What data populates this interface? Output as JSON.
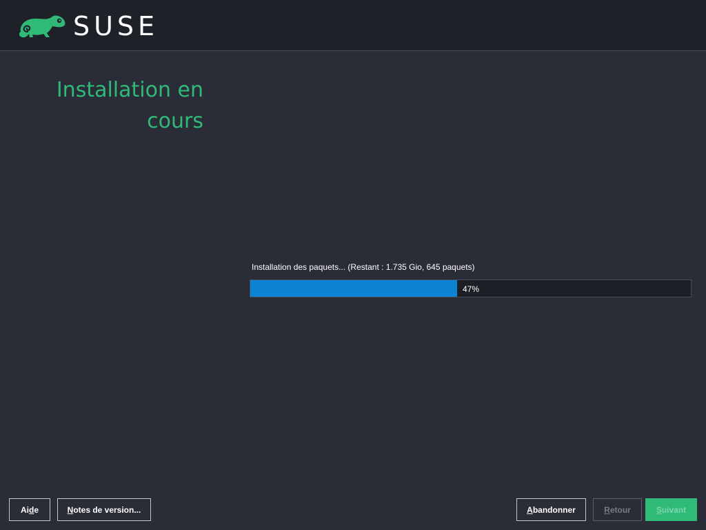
{
  "header": {
    "brand": "SUSE",
    "logo_icon": "chameleon-icon",
    "brand_color": "#30ba78"
  },
  "main": {
    "title_line1": "Installation en",
    "title_line2": "cours",
    "progress": {
      "label": "Installation des paquets... (Restant : 1.735 Gio, 645 paquets)",
      "percent": 47,
      "percent_text": "47%",
      "fill_color": "#0c83d3"
    }
  },
  "footer": {
    "help": {
      "pre": "Ai",
      "key": "d",
      "post": "e"
    },
    "notes": {
      "pre": "",
      "key": "N",
      "post": "otes de version..."
    },
    "abort": {
      "pre": "",
      "key": "A",
      "post": "bandonner"
    },
    "back": {
      "pre": "",
      "key": "R",
      "post": "etour"
    },
    "next": {
      "pre": "",
      "key": "S",
      "post": "uivant"
    }
  }
}
